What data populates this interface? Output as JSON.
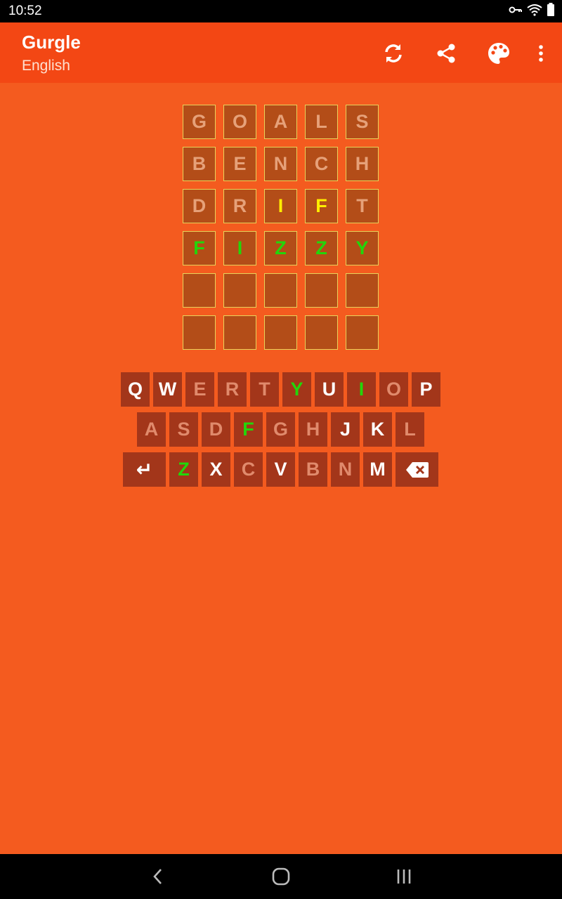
{
  "status_bar": {
    "time": "10:52",
    "icons": [
      "vpn-key-icon",
      "wifi-icon",
      "battery-icon"
    ]
  },
  "app_bar": {
    "title": "Gurgle",
    "subtitle": "English",
    "actions": [
      "refresh-icon",
      "share-icon",
      "palette-icon",
      "more-vert-icon"
    ]
  },
  "colors": {
    "background": "#f45b1f",
    "app_bar": "#f34714",
    "tile": "#b34d18",
    "tile_border": "#e8d35a",
    "key": "#a3361a",
    "correct": "#22d60a",
    "present": "#ffee00",
    "absent": "#e6a179"
  },
  "board": {
    "rows": [
      {
        "letters": [
          "G",
          "O",
          "A",
          "L",
          "S"
        ],
        "states": [
          "absent",
          "absent",
          "absent",
          "absent",
          "absent"
        ]
      },
      {
        "letters": [
          "B",
          "E",
          "N",
          "C",
          "H"
        ],
        "states": [
          "absent",
          "absent",
          "absent",
          "absent",
          "absent"
        ]
      },
      {
        "letters": [
          "D",
          "R",
          "I",
          "F",
          "T"
        ],
        "states": [
          "absent",
          "absent",
          "present",
          "present",
          "absent"
        ]
      },
      {
        "letters": [
          "F",
          "I",
          "Z",
          "Z",
          "Y"
        ],
        "states": [
          "correct",
          "correct",
          "correct",
          "correct",
          "correct"
        ]
      },
      {
        "letters": [
          "",
          "",
          "",
          "",
          ""
        ],
        "states": [
          "empty",
          "empty",
          "empty",
          "empty",
          "empty"
        ]
      },
      {
        "letters": [
          "",
          "",
          "",
          "",
          ""
        ],
        "states": [
          "empty",
          "empty",
          "empty",
          "empty",
          "empty"
        ]
      }
    ]
  },
  "keyboard": {
    "row1": [
      {
        "label": "Q",
        "state": "unused"
      },
      {
        "label": "W",
        "state": "unused"
      },
      {
        "label": "E",
        "state": "used"
      },
      {
        "label": "R",
        "state": "used"
      },
      {
        "label": "T",
        "state": "used"
      },
      {
        "label": "Y",
        "state": "correct"
      },
      {
        "label": "U",
        "state": "unused"
      },
      {
        "label": "I",
        "state": "correct"
      },
      {
        "label": "O",
        "state": "used"
      },
      {
        "label": "P",
        "state": "unused"
      }
    ],
    "row2": [
      {
        "label": "A",
        "state": "used"
      },
      {
        "label": "S",
        "state": "used"
      },
      {
        "label": "D",
        "state": "used"
      },
      {
        "label": "F",
        "state": "correct"
      },
      {
        "label": "G",
        "state": "used"
      },
      {
        "label": "H",
        "state": "used"
      },
      {
        "label": "J",
        "state": "unused"
      },
      {
        "label": "K",
        "state": "unused"
      },
      {
        "label": "L",
        "state": "used"
      }
    ],
    "row3": [
      {
        "label": "↵",
        "state": "unused",
        "icon": "enter-icon"
      },
      {
        "label": "Z",
        "state": "correct"
      },
      {
        "label": "X",
        "state": "unused"
      },
      {
        "label": "C",
        "state": "used"
      },
      {
        "label": "V",
        "state": "unused"
      },
      {
        "label": "B",
        "state": "used"
      },
      {
        "label": "N",
        "state": "used"
      },
      {
        "label": "M",
        "state": "unused"
      },
      {
        "label": "",
        "state": "unused",
        "icon": "backspace-icon"
      }
    ]
  },
  "nav_bar": {
    "buttons": [
      "back-icon",
      "home-icon",
      "recents-icon"
    ]
  }
}
